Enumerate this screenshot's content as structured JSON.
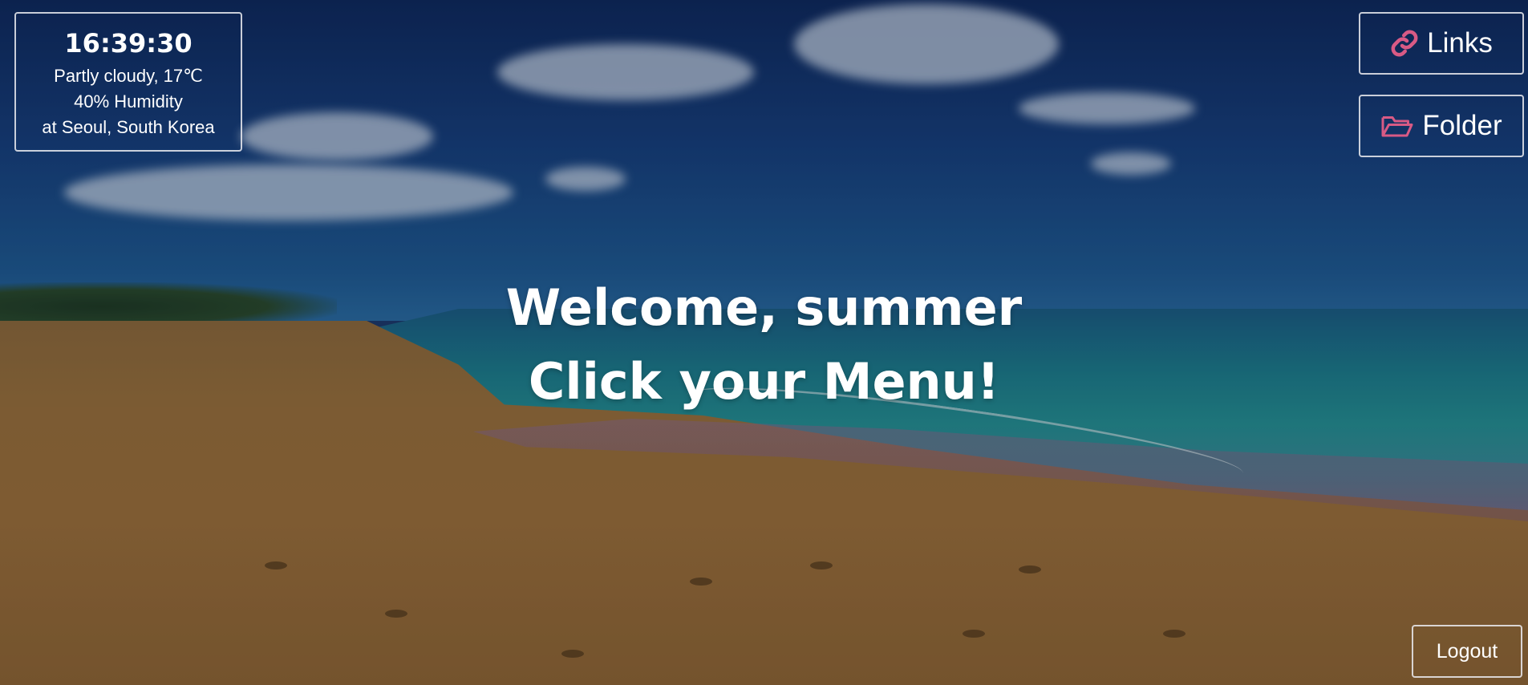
{
  "weather": {
    "time": "16:39:30",
    "condition": "Partly cloudy, 17℃",
    "humidity": "40% Humidity",
    "location": "at Seoul, South Korea"
  },
  "menu": {
    "links_label": "Links",
    "links_icon": "link-icon",
    "folder_label": "Folder",
    "folder_icon": "folder-open-icon"
  },
  "greeting": {
    "line1": "Welcome, summer",
    "line2": "Click your Menu!"
  },
  "logout_label": "Logout",
  "colors": {
    "icon_accent": "#d85a85",
    "text": "#ffffff",
    "border": "#ebebf0"
  }
}
